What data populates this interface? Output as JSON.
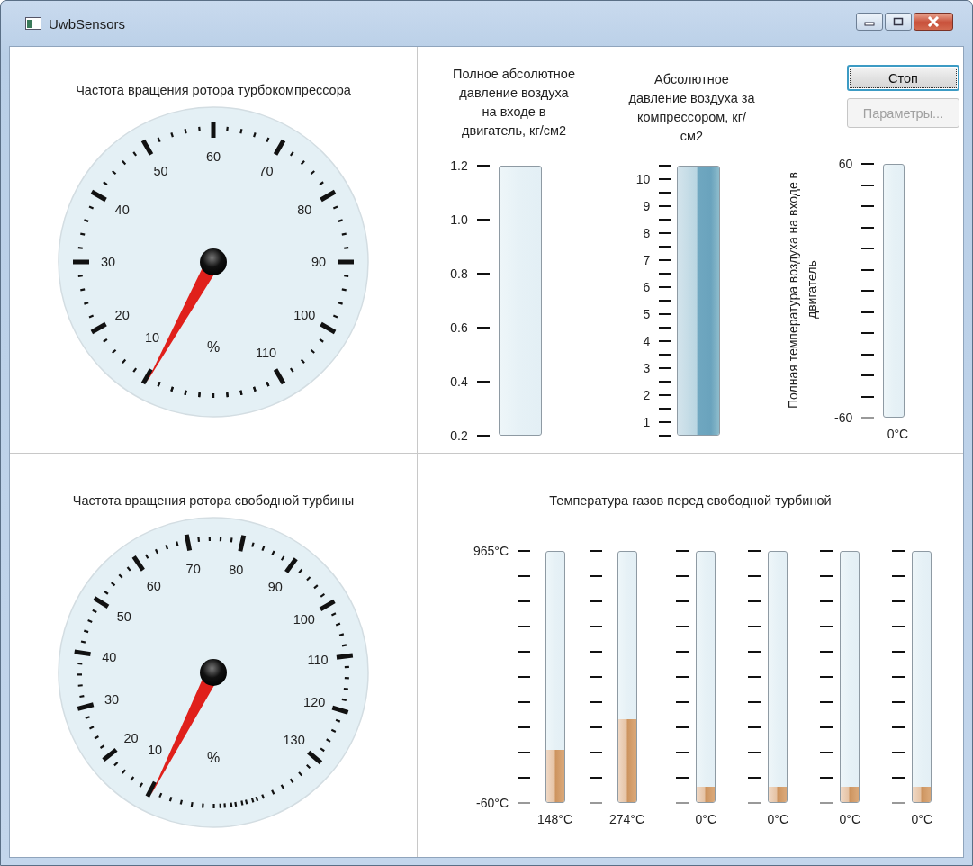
{
  "window": {
    "title": "UwbSensors"
  },
  "gauges": [
    {
      "title": "Частота вращения ротора турбокомпрессора",
      "unit": "%",
      "labels": [
        "10",
        "20",
        "30",
        "40",
        "50",
        "60",
        "70",
        "80",
        "90",
        "100",
        "110"
      ]
    },
    {
      "title": "Частота вращения ротора свободной турбины",
      "unit": "%",
      "labels": [
        "10",
        "20",
        "30",
        "40",
        "50",
        "60",
        "70",
        "80",
        "90",
        "100",
        "110",
        "120",
        "130"
      ]
    }
  ],
  "meters": [
    {
      "title": "Полное абсолютное давление воздуха на входе в двигатель, кг/см2",
      "scale": [
        "1.2",
        "1.0",
        "0.8",
        "0.6",
        "0.4",
        "0.2"
      ],
      "kind": "plain",
      "level": 0
    },
    {
      "title": "Абсолютное давление воздуха за компрессором, кг/см2",
      "scale": [
        "10",
        "9",
        "8",
        "7",
        "6",
        "5",
        "4",
        "3",
        "2",
        "1"
      ],
      "kind": "fine",
      "level": 1
    }
  ],
  "buttons": [
    {
      "label": "Стоп",
      "focused": true,
      "disabled": false
    },
    {
      "label": "Параметры...",
      "focused": false,
      "disabled": true
    }
  ],
  "air_temperature": {
    "title": "Полная температура воздуха на входе в двигатель",
    "scale": [
      "60",
      "-60"
    ],
    "level": 0,
    "reading": "0°C"
  },
  "gas_temperatures": {
    "title": "Температура газов перед свободной турбиной",
    "scale": [
      "965°C",
      "-60°C"
    ],
    "sensors": [
      {
        "reading": "148°C",
        "level": 0.21
      },
      {
        "reading": "274°C",
        "level": 0.33
      },
      {
        "reading": "0°C",
        "level": 0.06
      },
      {
        "reading": "0°C",
        "level": 0.06
      },
      {
        "reading": "0°C",
        "level": 0.06
      },
      {
        "reading": "0°C",
        "level": 0.06
      }
    ]
  }
}
